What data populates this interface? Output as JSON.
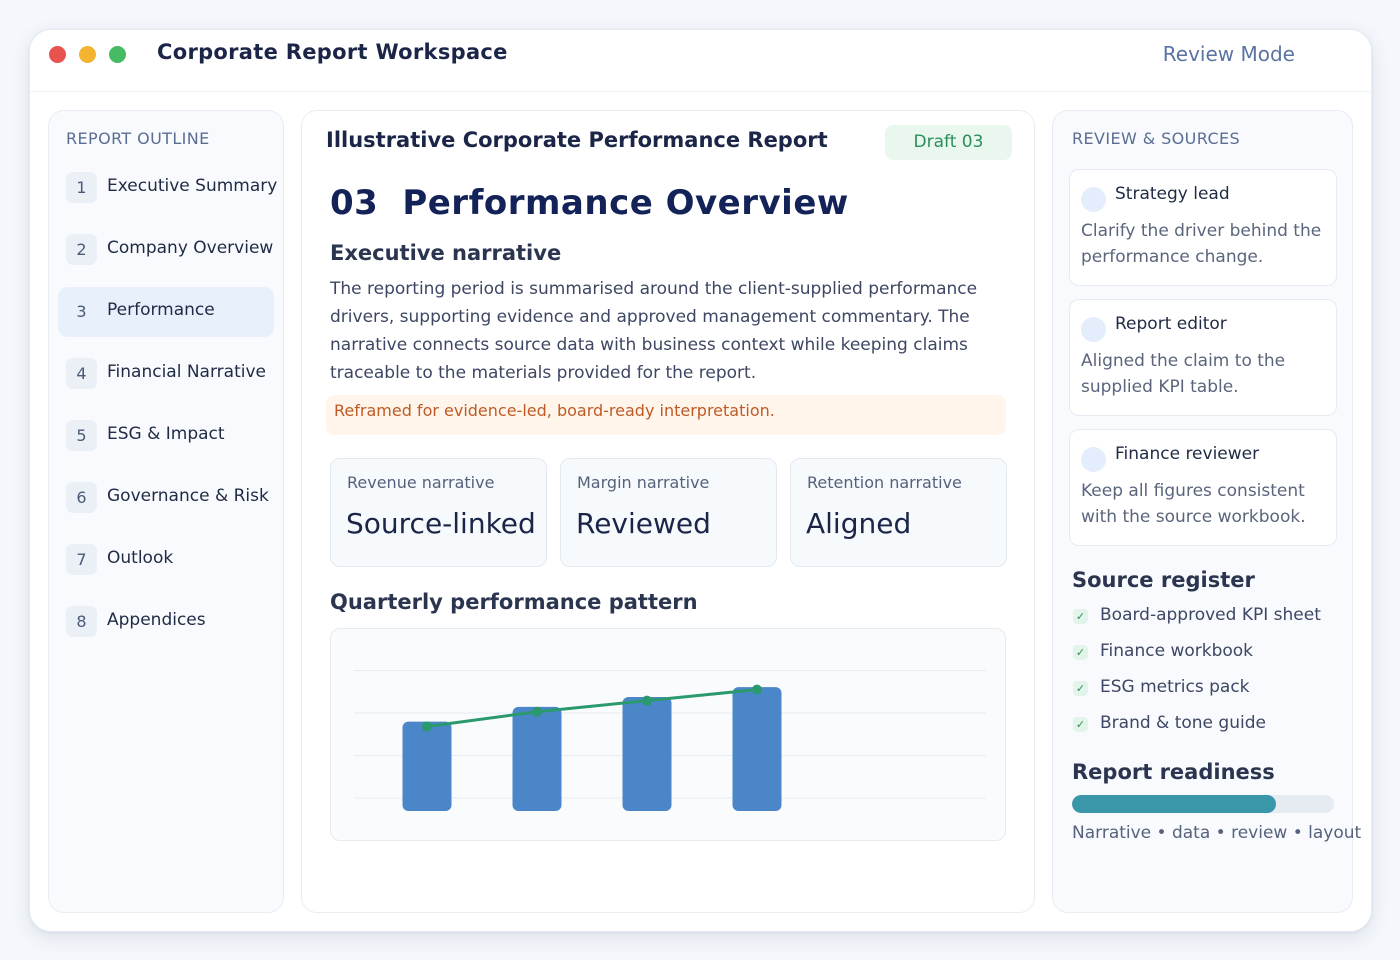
{
  "window": {
    "title": "Corporate Report Workspace",
    "mode": "Review Mode"
  },
  "outline": {
    "heading": "REPORT OUTLINE",
    "items": [
      {
        "num": "1",
        "label": "Executive Summary",
        "active": false
      },
      {
        "num": "2",
        "label": "Company Overview",
        "active": false
      },
      {
        "num": "3",
        "label": "Performance",
        "active": true
      },
      {
        "num": "4",
        "label": "Financial Narrative",
        "active": false
      },
      {
        "num": "5",
        "label": "ESG & Impact",
        "active": false
      },
      {
        "num": "6",
        "label": "Governance & Risk",
        "active": false
      },
      {
        "num": "7",
        "label": "Outlook",
        "active": false
      },
      {
        "num": "8",
        "label": "Appendices",
        "active": false
      }
    ]
  },
  "main": {
    "doc_title": "Illustrative Corporate Performance Report",
    "draft_badge": "Draft 03",
    "section_num": "03",
    "section_title": "Performance Overview",
    "narrative_heading": "Executive narrative",
    "narrative_text": "The reporting period is summarised around the client-supplied performance drivers, supporting evidence and approved management commentary. The narrative connects source data with business context while keeping claims traceable to the materials provided for the report.",
    "callout": "Reframed for evidence-led, board-ready interpretation.",
    "kpis": [
      {
        "label": "Revenue narrative",
        "value": "Source-linked"
      },
      {
        "label": "Margin narrative",
        "value": "Reviewed"
      },
      {
        "label": "Retention narrative",
        "value": "Aligned"
      }
    ],
    "chart_heading": "Quarterly performance pattern"
  },
  "chart_data": {
    "type": "bar",
    "categories": [
      "",
      "",
      "",
      ""
    ],
    "values": [
      62,
      74,
      82,
      90
    ],
    "series": [
      {
        "type": "bar",
        "values": [
          62,
          74,
          82,
          90
        ]
      },
      {
        "type": "line",
        "values": [
          58,
          70,
          79,
          88
        ]
      }
    ],
    "ylim": [
      0,
      125
    ],
    "grid": true,
    "title": "",
    "xlabel": "",
    "ylabel": "",
    "colors": {
      "bar": "#4a86c8",
      "line": "#2a9a6e"
    }
  },
  "review": {
    "heading": "REVIEW & SOURCES",
    "comments": [
      {
        "author": "Strategy lead",
        "text": "Clarify the driver behind the performance change."
      },
      {
        "author": "Report editor",
        "text": "Aligned the claim to the supplied KPI table."
      },
      {
        "author": "Finance reviewer",
        "text": "Keep all figures consistent with the source workbook."
      }
    ],
    "source_heading": "Source register",
    "sources": [
      "Board-approved KPI sheet",
      "Finance workbook",
      "ESG metrics pack",
      "Brand & tone guide"
    ],
    "check_glyph": "✓",
    "readiness_heading": "Report readiness",
    "readiness_percent": 78,
    "readiness_caption": "Narrative • data • review • layout"
  },
  "colors": {
    "accent": "#132257",
    "badge_green": "#2a8f58",
    "callout_orange": "#bf5a25",
    "progress": "#3a97a9"
  }
}
